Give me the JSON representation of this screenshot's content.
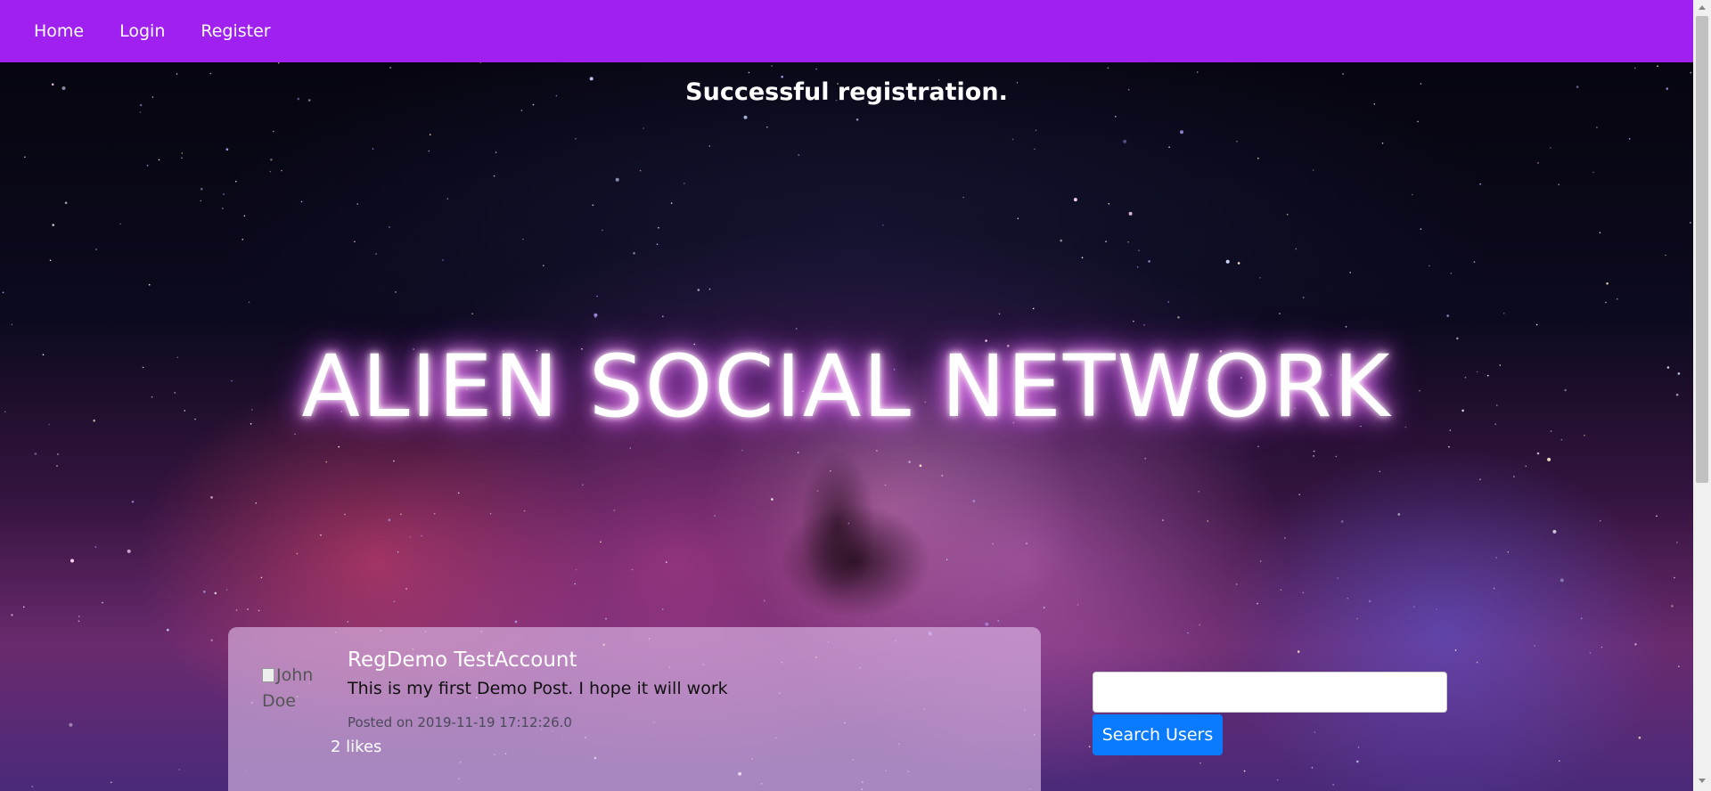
{
  "navbar": {
    "color": "#a020f0",
    "links": [
      {
        "label": "Home"
      },
      {
        "label": "Login"
      },
      {
        "label": "Register"
      }
    ]
  },
  "flash_message": "Successful registration.",
  "site_title": "ALIEN SOCIAL NETWORK",
  "post": {
    "avatar_alt": "John Doe",
    "author": "RegDemo TestAccount",
    "body": "This is my first Demo Post. I hope it will work",
    "posted_on": "Posted on 2019-11-19 17:12:26.0",
    "likes": "2 likes"
  },
  "search": {
    "value": "",
    "button_label": "Search Users",
    "button_color": "#0a7bff"
  }
}
